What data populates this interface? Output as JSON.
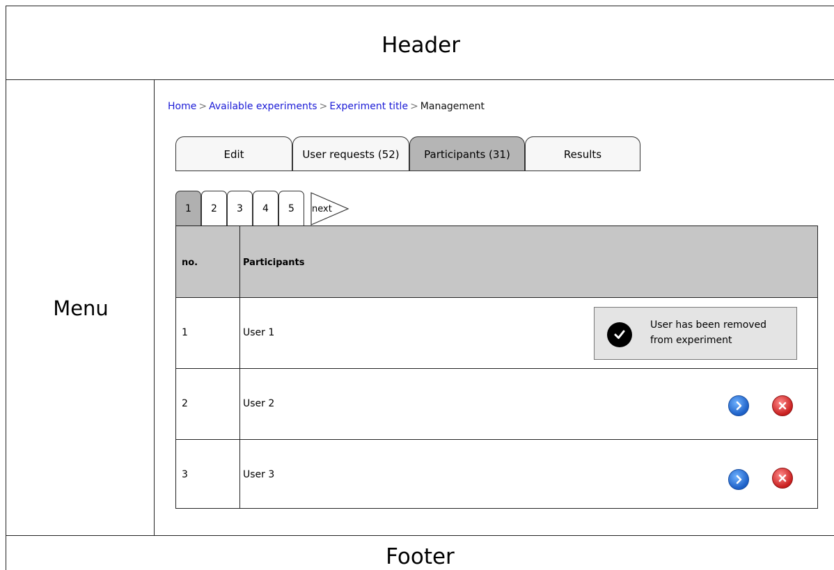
{
  "header": {
    "title": "Header"
  },
  "menu": {
    "title": "Menu"
  },
  "footer": {
    "title": "Footer"
  },
  "breadcrumb": {
    "items": [
      "Home",
      "Available experiments",
      "Experiment title",
      "Management"
    ],
    "separator": ">"
  },
  "tabs": [
    {
      "label": "Edit",
      "active": false
    },
    {
      "label": "User requests (52)",
      "active": false
    },
    {
      "label": "Participants (31)",
      "active": true
    },
    {
      "label": "Results",
      "active": false
    }
  ],
  "pagination": {
    "pages": [
      "1",
      "2",
      "3",
      "4",
      "5"
    ],
    "current": "1",
    "next_label": "next"
  },
  "table": {
    "headers": [
      "no.",
      "Participants"
    ],
    "rows": [
      {
        "no": "1",
        "participant": "User 1"
      },
      {
        "no": "2",
        "participant": "User 2"
      },
      {
        "no": "3",
        "participant": "User 3"
      }
    ]
  },
  "notification": {
    "icon": "check-circle-icon",
    "line1": "User has been removed",
    "line2": "from experiment"
  },
  "row_actions": {
    "open_icon": "chevron-right-icon",
    "remove_icon": "remove-x-icon"
  },
  "colors": {
    "link": "#1a1ad6",
    "active_tab": "#b5b5b5",
    "table_header": "#c6c6c6",
    "open_button": "#1c5fc6",
    "remove_button": "#c81e1e"
  }
}
